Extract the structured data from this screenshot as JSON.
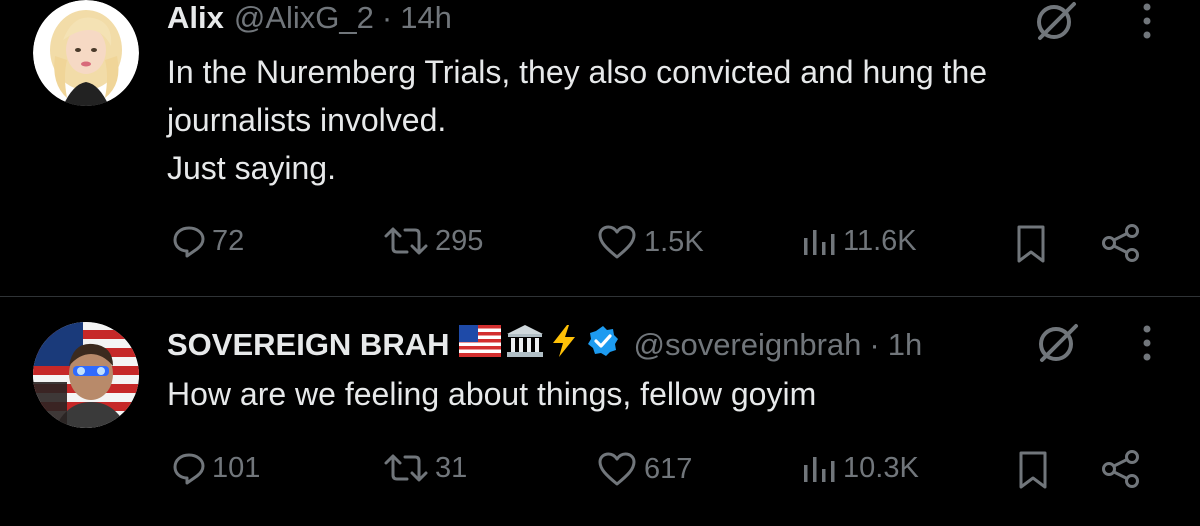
{
  "tweets": [
    {
      "name": "Alix",
      "handle": "@AlixG_2",
      "separator": "·",
      "time": "14h",
      "text_lines": [
        "In the Nuremberg Trials, they also convicted and hung the",
        "journalists involved.",
        "Just saying."
      ],
      "replies": "72",
      "reposts": "295",
      "likes": "1.5K",
      "views": "11.6K",
      "avatar_icon": "cartoon-blonde-woman-avatar"
    },
    {
      "name": "SOVEREIGN BRAH",
      "handle": "@sovereignbrah",
      "separator": "·",
      "time": "1h",
      "text_lines": [
        "How are we feeling about things, fellow goyim"
      ],
      "name_emojis": [
        "us-flag-icon",
        "classical-building-icon",
        "lightning-bolt-icon"
      ],
      "verified": true,
      "replies": "101",
      "reposts": "31",
      "likes": "617",
      "views": "10.3K",
      "avatar_icon": "man-with-glowing-eyes-flag-avatar"
    }
  ],
  "colors": {
    "background": "#000000",
    "primary_text": "#e7e9ea",
    "secondary_text": "#71767b",
    "divider": "#2f3336",
    "verified_blue": "#1d9bf0"
  }
}
